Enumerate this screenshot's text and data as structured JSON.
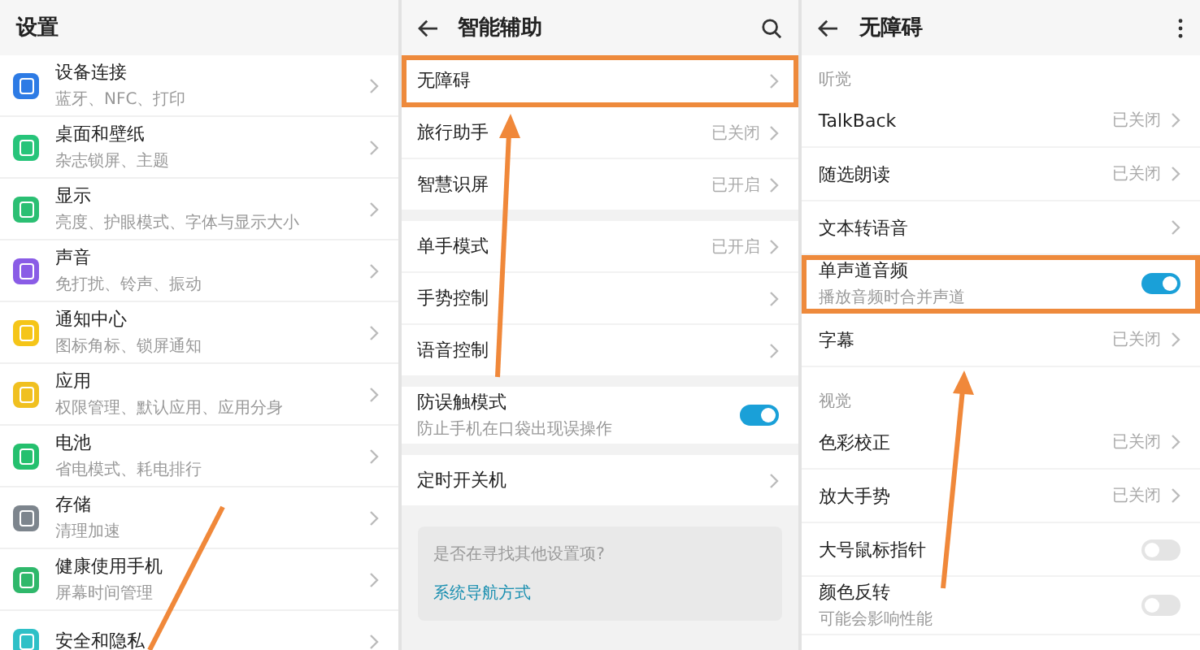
{
  "settings": {
    "title": "设置",
    "items": [
      {
        "title": "设备连接",
        "subtitle": "蓝牙、NFC、打印",
        "color": "#2d7be5"
      },
      {
        "title": "桌面和壁纸",
        "subtitle": "杂志锁屏、主题",
        "color": "#27c47a"
      },
      {
        "title": "显示",
        "subtitle": "亮度、护眼模式、字体与显示大小",
        "color": "#2bbf73"
      },
      {
        "title": "声音",
        "subtitle": "免打扰、铃声、振动",
        "color": "#8a5ce6"
      },
      {
        "title": "通知中心",
        "subtitle": "图标角标、锁屏通知",
        "color": "#f5c518"
      },
      {
        "title": "应用",
        "subtitle": "权限管理、默认应用、应用分身",
        "color": "#f0c020"
      },
      {
        "title": "电池",
        "subtitle": "省电模式、耗电排行",
        "color": "#25c06e"
      },
      {
        "title": "存储",
        "subtitle": "清理加速",
        "color": "#7d858d"
      },
      {
        "title": "健康使用手机",
        "subtitle": "屏幕时间管理",
        "color": "#2fb86b"
      },
      {
        "title": "安全和隐私",
        "color": "#2ec0c7"
      }
    ]
  },
  "smart_assist": {
    "title": "智能辅助",
    "groups": [
      [
        {
          "kind": "link",
          "title": "无障碍",
          "highlighted": true
        },
        {
          "kind": "link",
          "title": "旅行助手",
          "value": "已关闭",
          "highlighted": false
        },
        {
          "kind": "link",
          "title": "智慧识屏",
          "value": "已开启",
          "highlighted": false
        }
      ],
      [
        {
          "kind": "link",
          "title": "单手模式",
          "value": "已开启",
          "highlighted": false
        },
        {
          "kind": "link",
          "title": "手势控制",
          "highlighted": false
        },
        {
          "kind": "link",
          "title": "语音控制",
          "highlighted": false
        }
      ],
      [
        {
          "kind": "toggle",
          "title": "防误触模式",
          "subtitle": "防止手机在口袋出现误操作",
          "on": true,
          "highlighted": false
        }
      ],
      [
        {
          "kind": "link",
          "title": "定时开关机",
          "highlighted": false
        }
      ]
    ],
    "hint_card": {
      "text": "是否在寻找其他设置项?",
      "link": "系统导航方式"
    }
  },
  "accessibility": {
    "title": "无障碍",
    "sections": [
      {
        "label": "听觉",
        "rows": [
          {
            "kind": "link",
            "title": "TalkBack",
            "value": "已关闭",
            "highlighted": false
          },
          {
            "kind": "link",
            "title": "随选朗读",
            "value": "已关闭",
            "highlighted": false
          },
          {
            "kind": "link",
            "title": "文本转语音",
            "highlighted": false
          },
          {
            "kind": "toggle",
            "title": "单声道音频",
            "subtitle": "播放音频时合并声道",
            "on": true,
            "highlighted": true
          },
          {
            "kind": "link",
            "title": "字幕",
            "value": "已关闭",
            "highlighted": false
          }
        ]
      },
      {
        "label": "视觉",
        "rows": [
          {
            "kind": "link",
            "title": "色彩校正",
            "value": "已关闭",
            "highlighted": false
          },
          {
            "kind": "link",
            "title": "放大手势",
            "value": "已关闭",
            "highlighted": false
          },
          {
            "kind": "toggle",
            "title": "大号鼠标指针",
            "on": false,
            "highlighted": false
          },
          {
            "kind": "toggle",
            "title": "颜色反转",
            "subtitle": "可能会影响性能",
            "on": false,
            "highlighted": false
          }
        ]
      }
    ]
  }
}
